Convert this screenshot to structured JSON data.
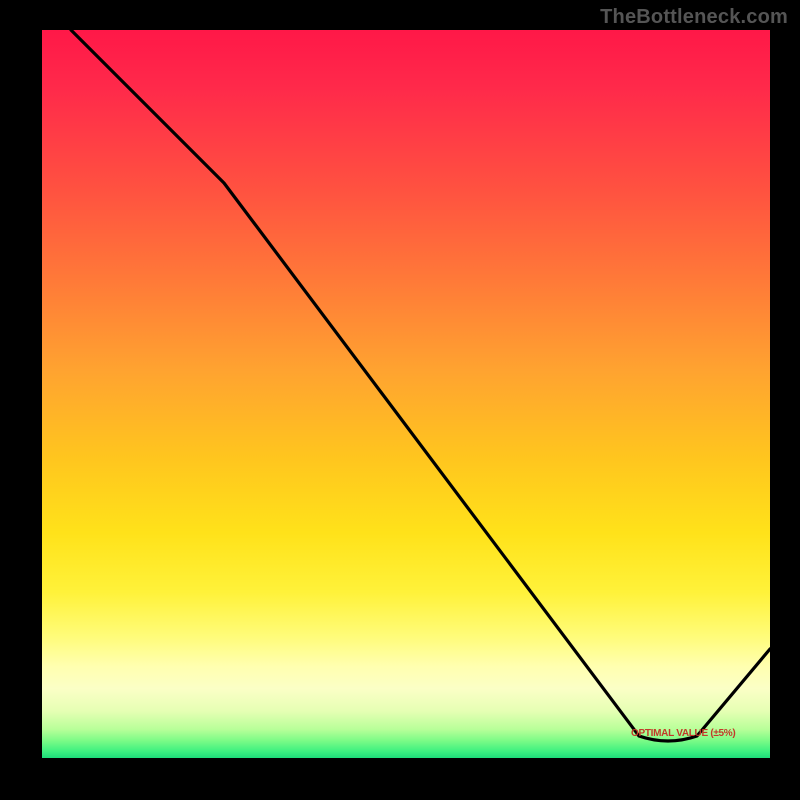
{
  "branding": {
    "watermark": "TheBottleneck.com"
  },
  "labels": {
    "optimal_marker_text": "OPTIMAL VALUE (±5%)"
  },
  "chart_data": {
    "type": "line",
    "title": "",
    "xlabel": "",
    "ylabel": "",
    "xlim": [
      0,
      100
    ],
    "ylim": [
      0,
      100
    ],
    "series": [
      {
        "name": "curve",
        "x": [
          4,
          25,
          82,
          90,
          100
        ],
        "values": [
          100,
          79,
          3,
          3,
          15
        ]
      }
    ],
    "gradient_stops": [
      {
        "pos": 0,
        "rating": "worst",
        "color": "#ff1848"
      },
      {
        "pos": 50,
        "rating": "mid",
        "color": "#ffc61e"
      },
      {
        "pos": 88,
        "rating": "good",
        "color": "#ffffb0"
      },
      {
        "pos": 100,
        "rating": "best",
        "color": "#0aa067"
      }
    ],
    "optimal_marker": {
      "x": 86,
      "y": 3
    }
  }
}
